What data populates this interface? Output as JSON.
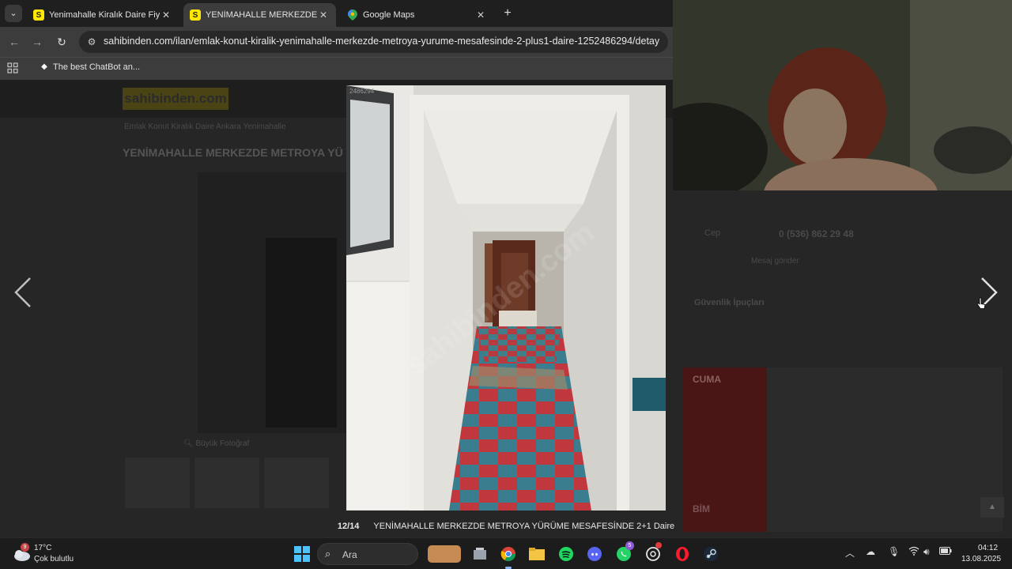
{
  "browser": {
    "tabs": [
      {
        "title": "Yenimahalle Kiralık Daire Fiyatla",
        "favicon": "sahibinden-favicon",
        "active": false
      },
      {
        "title": "YENİMAHALLE MERKEZDE MET",
        "favicon": "sahibinden-favicon",
        "active": true
      },
      {
        "title": "Google Maps",
        "favicon": "google-maps-favicon",
        "active": false
      }
    ],
    "favicon_letter": "S",
    "url": "sahibinden.com/ilan/emlak-konut-kiralik-yenimahalle-merkezde-metroya-yurume-mesafesinde-2-plus1-daire-1252486294/detay",
    "bookmark": "The best ChatBot an..."
  },
  "page": {
    "logo": "sahibinden.com",
    "breadcrumb": "Emlak    Konut    Kiralık    Daire    Ankara    Yenimahalle",
    "listing_title": "YENİMAHALLE MERKEZDE METROYA YÜ",
    "enlarge_label": "Büyük Fotoğraf",
    "phone_label": "Cep",
    "phone_number": "0 (536) 862 29 48",
    "message_label": "Mesaj gönder",
    "safety_title": "Güvenlik İpuçları",
    "ad_text_1": "CUMA",
    "ad_text_2": "BİM"
  },
  "lightbox": {
    "counter": "12/14",
    "caption": "YENİMAHALLE MERKEZDE METROYA YÜRÜME MESAFESİNDE 2+1 Daire",
    "watermark": "sahibinden.com",
    "image_id": "2486294"
  },
  "taskbar": {
    "weather_temp": "17°C",
    "weather_desc": "Çok bulutlu",
    "weather_badge": "9",
    "search_placeholder": "Ara",
    "whatsapp_badge": "5",
    "time": "04:12",
    "date": "13.08.2025"
  },
  "colors": {
    "sahibinden_yellow": "#ffe800",
    "chrome_dark": "#3c3c3c",
    "floor_red": "#c0373e",
    "floor_blue": "#3a7d8f"
  }
}
